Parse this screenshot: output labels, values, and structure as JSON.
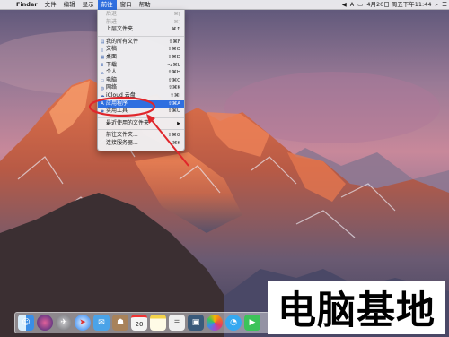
{
  "menubar": {
    "apple_icon": "apple-icon",
    "items": [
      {
        "label": "Finder",
        "bold": true
      },
      {
        "label": "文件"
      },
      {
        "label": "编辑"
      },
      {
        "label": "显示"
      },
      {
        "label": "前往",
        "active": true
      },
      {
        "label": "窗口"
      },
      {
        "label": "帮助"
      }
    ],
    "status": {
      "ime": "A",
      "datetime": "4月20日 周五下午11:44"
    }
  },
  "go_menu": {
    "items": [
      {
        "label": "后退",
        "shortcut": "⌘[",
        "disabled": true
      },
      {
        "label": "前进",
        "shortcut": "⌘]",
        "disabled": true
      },
      {
        "label": "上层文件夹",
        "shortcut": "⌘↑"
      },
      {
        "sep": true
      },
      {
        "label": "我的所有文件",
        "shortcut": "⇧⌘F",
        "icon": "all-files-icon"
      },
      {
        "label": "文稿",
        "shortcut": "⇧⌘O",
        "icon": "documents-icon"
      },
      {
        "label": "桌面",
        "shortcut": "⇧⌘D",
        "icon": "desktop-icon"
      },
      {
        "label": "下载",
        "shortcut": "⌥⌘L",
        "icon": "downloads-icon"
      },
      {
        "label": "个人",
        "shortcut": "⇧⌘H",
        "icon": "home-icon"
      },
      {
        "label": "电脑",
        "shortcut": "⇧⌘C",
        "icon": "computer-icon"
      },
      {
        "label": "网络",
        "shortcut": "⇧⌘K",
        "icon": "network-icon"
      },
      {
        "label": "iCloud 云盘",
        "shortcut": "⇧⌘I",
        "icon": "icloud-icon"
      },
      {
        "label": "应用程序",
        "shortcut": "⇧⌘A",
        "icon": "applications-icon",
        "highlighted": true
      },
      {
        "label": "实用工具",
        "shortcut": "⇧⌘U",
        "icon": "utilities-icon"
      },
      {
        "sep": true
      },
      {
        "label": "最近使用的文件夹",
        "submenu": true
      },
      {
        "sep": true
      },
      {
        "label": "前往文件夹...",
        "shortcut": "⇧⌘G"
      },
      {
        "label": "连接服务器...",
        "shortcut": "⌘K"
      }
    ]
  },
  "dock": {
    "items": [
      {
        "icon": "finder-icon",
        "color": "#3a8ee6"
      },
      {
        "icon": "siri-icon",
        "color": "#5b3fa8"
      },
      {
        "icon": "launchpad-icon",
        "color": "#8e8e93"
      },
      {
        "icon": "safari-icon",
        "color": "#1e7cf0"
      },
      {
        "icon": "mail-icon",
        "color": "#4aa3e8"
      },
      {
        "icon": "contacts-icon",
        "color": "#a8825a"
      },
      {
        "icon": "calendar-icon",
        "color": "#f4f4f4",
        "text": "20"
      },
      {
        "icon": "notes-icon",
        "color": "#f5d34a"
      },
      {
        "icon": "reminders-icon",
        "color": "#f0f0f0"
      },
      {
        "icon": "photo-booth-icon",
        "color": "#3a5a7a"
      },
      {
        "icon": "photos-icon",
        "color": "#f0f0f0"
      },
      {
        "icon": "messages-icon",
        "color": "#35a8f0"
      },
      {
        "icon": "facetime-icon",
        "color": "#3cc35a"
      }
    ]
  },
  "watermark": {
    "text": "电脑基地"
  },
  "colors": {
    "highlight": "#2f6fe0",
    "annotation": "#e0262b"
  }
}
